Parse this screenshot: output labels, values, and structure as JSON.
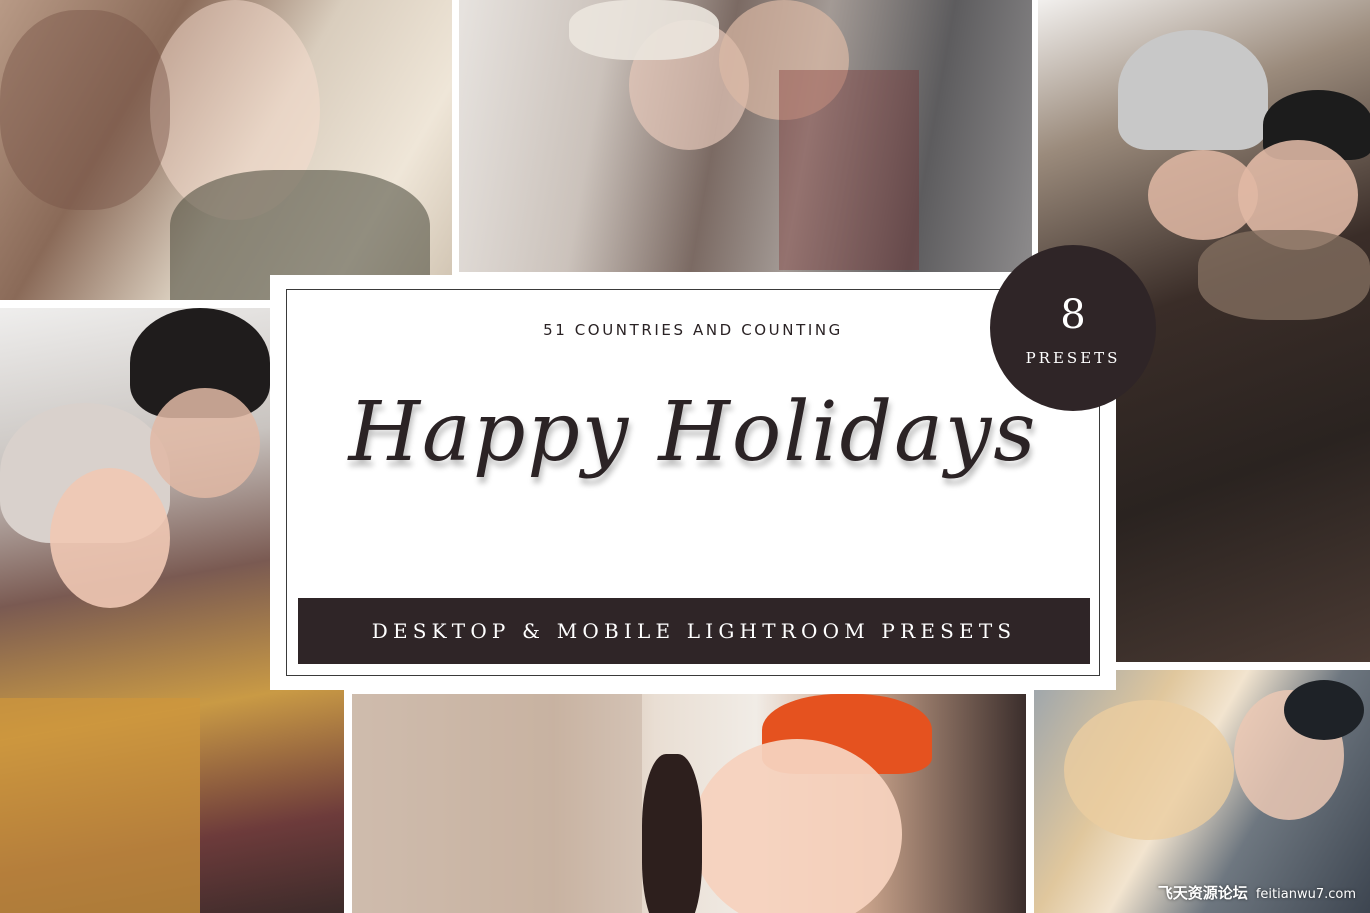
{
  "header": {
    "subtitle": "51 COUNTRIES AND COUNTING",
    "title": "Happy Holidays"
  },
  "banner": {
    "label": "DESKTOP & MOBILE LIGHTROOM PRESETS"
  },
  "badge": {
    "number": "8",
    "label": "PRESETS"
  },
  "watermark": {
    "text_cn": "飞天资源论坛",
    "text": "feitianwu7.com"
  },
  "colors": {
    "accent": "#2f2527",
    "card": "#ffffff",
    "text": "#2b2325"
  }
}
